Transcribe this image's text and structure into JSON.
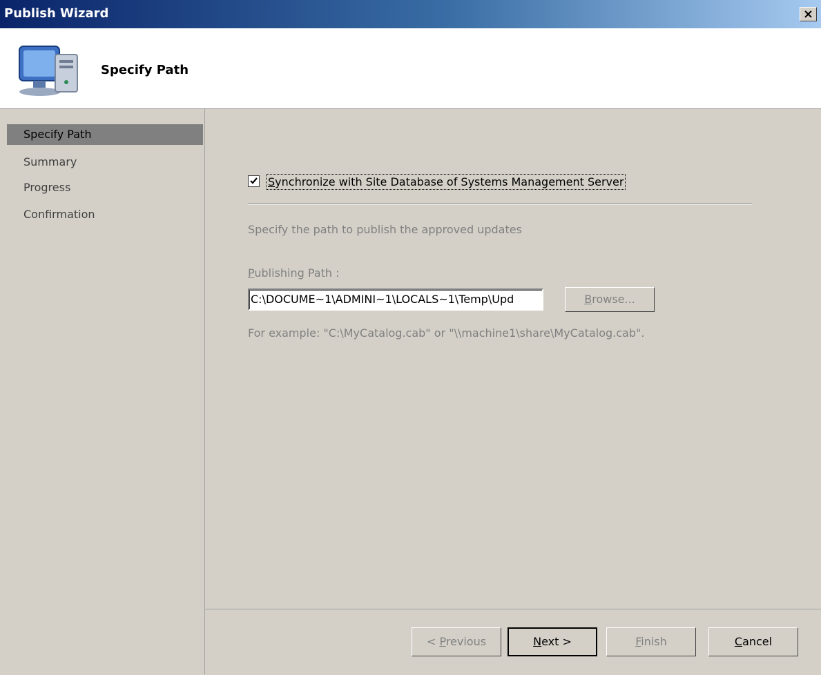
{
  "window": {
    "title": "Publish Wizard"
  },
  "header": {
    "heading": "Specify Path",
    "icon": "computer-icon"
  },
  "sidebar": {
    "steps": [
      {
        "label": "Specify Path",
        "active": true
      },
      {
        "label": "Summary"
      },
      {
        "label": "Progress"
      },
      {
        "label": "Confirmation"
      }
    ]
  },
  "main": {
    "sync_checkbox": {
      "label_prefix": "S",
      "label_rest": "ynchronize with Site Database of Systems Management Server",
      "checked": true
    },
    "description": "Specify the path to publish the approved updates",
    "path_label_prefix": "P",
    "path_label_rest": "ublishing Path :",
    "path_value": "C:\\DOCUME~1\\ADMINI~1\\LOCALS~1\\Temp\\Upd",
    "browse": {
      "prefix": "B",
      "rest": "rowse..."
    },
    "example": "For example: \"C:\\MyCatalog.cab\" or \"\\\\machine1\\share\\MyCatalog.cab\"."
  },
  "footer": {
    "previous": {
      "before": "< ",
      "key": "P",
      "after": "revious",
      "enabled": false
    },
    "next": {
      "key": "N",
      "after": "ext >",
      "enabled": true
    },
    "finish": {
      "key": "F",
      "after": "inish",
      "enabled": false
    },
    "cancel": {
      "key": "C",
      "after": "ancel",
      "enabled": true
    }
  }
}
